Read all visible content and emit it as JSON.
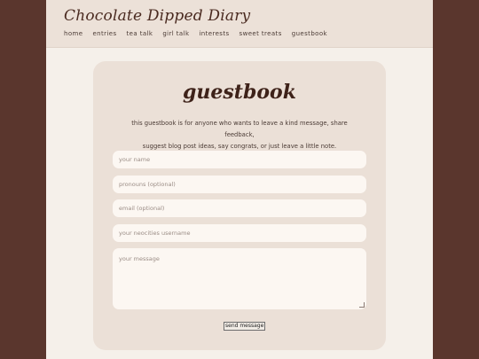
{
  "site": {
    "title": "Chocolate Dipped Diary",
    "nav": [
      "home",
      "entries",
      "tea talk",
      "girl talk",
      "interests",
      "sweet treats",
      "guestbook"
    ]
  },
  "guestbook": {
    "title": "guestbook",
    "intro_line1": "this guestbook is for anyone who wants to leave a kind message, share feedback,",
    "intro_line2": "suggest blog post ideas, say congrats, or just leave a little note.",
    "fields": {
      "name_placeholder": "your name",
      "pronouns_placeholder": "pronouns (optional)",
      "email_placeholder": "email (optional)",
      "neocities_placeholder": "your neocities username",
      "message_placeholder": "your message"
    },
    "send_label": "send message"
  }
}
